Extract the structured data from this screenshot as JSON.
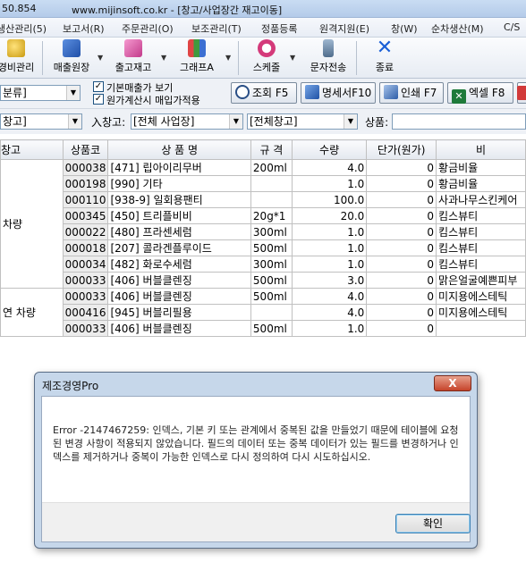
{
  "titlebar": {
    "left_text": "50.854",
    "center_text": "www.mijinsoft.co.kr - [창고/사업장간 재고이동]"
  },
  "menu": [
    "생산관리(5)",
    "보고서(R)",
    "주문관리(O)",
    "보조관리(T)",
    "정품등록",
    "원격지원(E)",
    "창(W)",
    "순차생산(M)",
    "C/S"
  ],
  "toolbar": {
    "items": [
      {
        "label": "경비관리",
        "icon": "coins-icon"
      },
      {
        "label": "매출원장",
        "icon": "ledger-icon"
      },
      {
        "label": "출고재고",
        "icon": "stock-icon"
      },
      {
        "label": "그래프A",
        "icon": "chart-icon"
      },
      {
        "label": "스케줄",
        "icon": "clock-icon"
      },
      {
        "label": "문자전송",
        "icon": "phone-icon"
      },
      {
        "label": "종료",
        "icon": "close-x-icon"
      }
    ]
  },
  "filters": {
    "category": "분류]",
    "check1": "기본매출가 보기",
    "check2": "원가계산시 매입가적용",
    "buttons": [
      "조회 F5",
      "명세서F10",
      "인쇄 F7",
      "엑셀 F8"
    ],
    "warehouse": "창고]",
    "inout_label": "入창고:",
    "site": "[전체 사업장]",
    "warehouse_all": "[전체창고]",
    "product_label": "상품:"
  },
  "table": {
    "headers": [
      "창고",
      "상품코",
      "상 품 명",
      "규 격",
      "수량",
      "단가(원가)",
      "비"
    ],
    "groups": [
      {
        "name": "차량",
        "rows": [
          [
            "000038",
            "[471] 립아이리무버",
            "200ml",
            "4.0",
            "0",
            "황금비율"
          ],
          [
            "000198",
            "[990] 기타",
            "",
            "1.0",
            "0",
            "황금비율"
          ],
          [
            "000110",
            "[938-9] 일회용팬티",
            "",
            "100.0",
            "0",
            "사과나무스킨케어"
          ],
          [
            "000345",
            "[450] 트리플비비",
            "20g*1",
            "20.0",
            "0",
            "킴스뷰티"
          ],
          [
            "000022",
            "[480] 프라센세럼",
            "300ml",
            "1.0",
            "0",
            "킴스뷰티"
          ],
          [
            "000018",
            "[207] 콜라겐플루이드",
            "500ml",
            "1.0",
            "0",
            "킴스뷰티"
          ],
          [
            "000034",
            "[482] 화로수세럼",
            "300ml",
            "1.0",
            "0",
            "킴스뷰티"
          ],
          [
            "000033",
            "[406] 버블클렌징",
            "500ml",
            "3.0",
            "0",
            "맑은얼굴예쁜피부"
          ]
        ]
      },
      {
        "name": "연 차량",
        "rows": [
          [
            "000033",
            "[406] 버블클렌징",
            "500ml",
            "4.0",
            "0",
            "미지용에스테틱"
          ],
          [
            "000416",
            "[945] 버블리필용",
            "",
            "4.0",
            "0",
            "미지용에스테틱"
          ],
          [
            "000033",
            "[406] 버블클렌징",
            "500ml",
            "1.0",
            "0",
            ""
          ]
        ]
      }
    ]
  },
  "dialog": {
    "title": "제조경영Pro",
    "close": "X",
    "message": "Error -2147467259: 인덱스, 기본 키 또는 관계에서 중복된 값을 만들었기 때문에 테이블에 요청된 변경 사항이 적용되지 않았습니다. 필드의 데이터 또는 중복 데이터가 있는 필드를 변경하거나 인덱스를 제거하거나 중복이 가능한 인덱스로 다시 정의하여 다시 시도하십시오.",
    "ok": "확인"
  }
}
